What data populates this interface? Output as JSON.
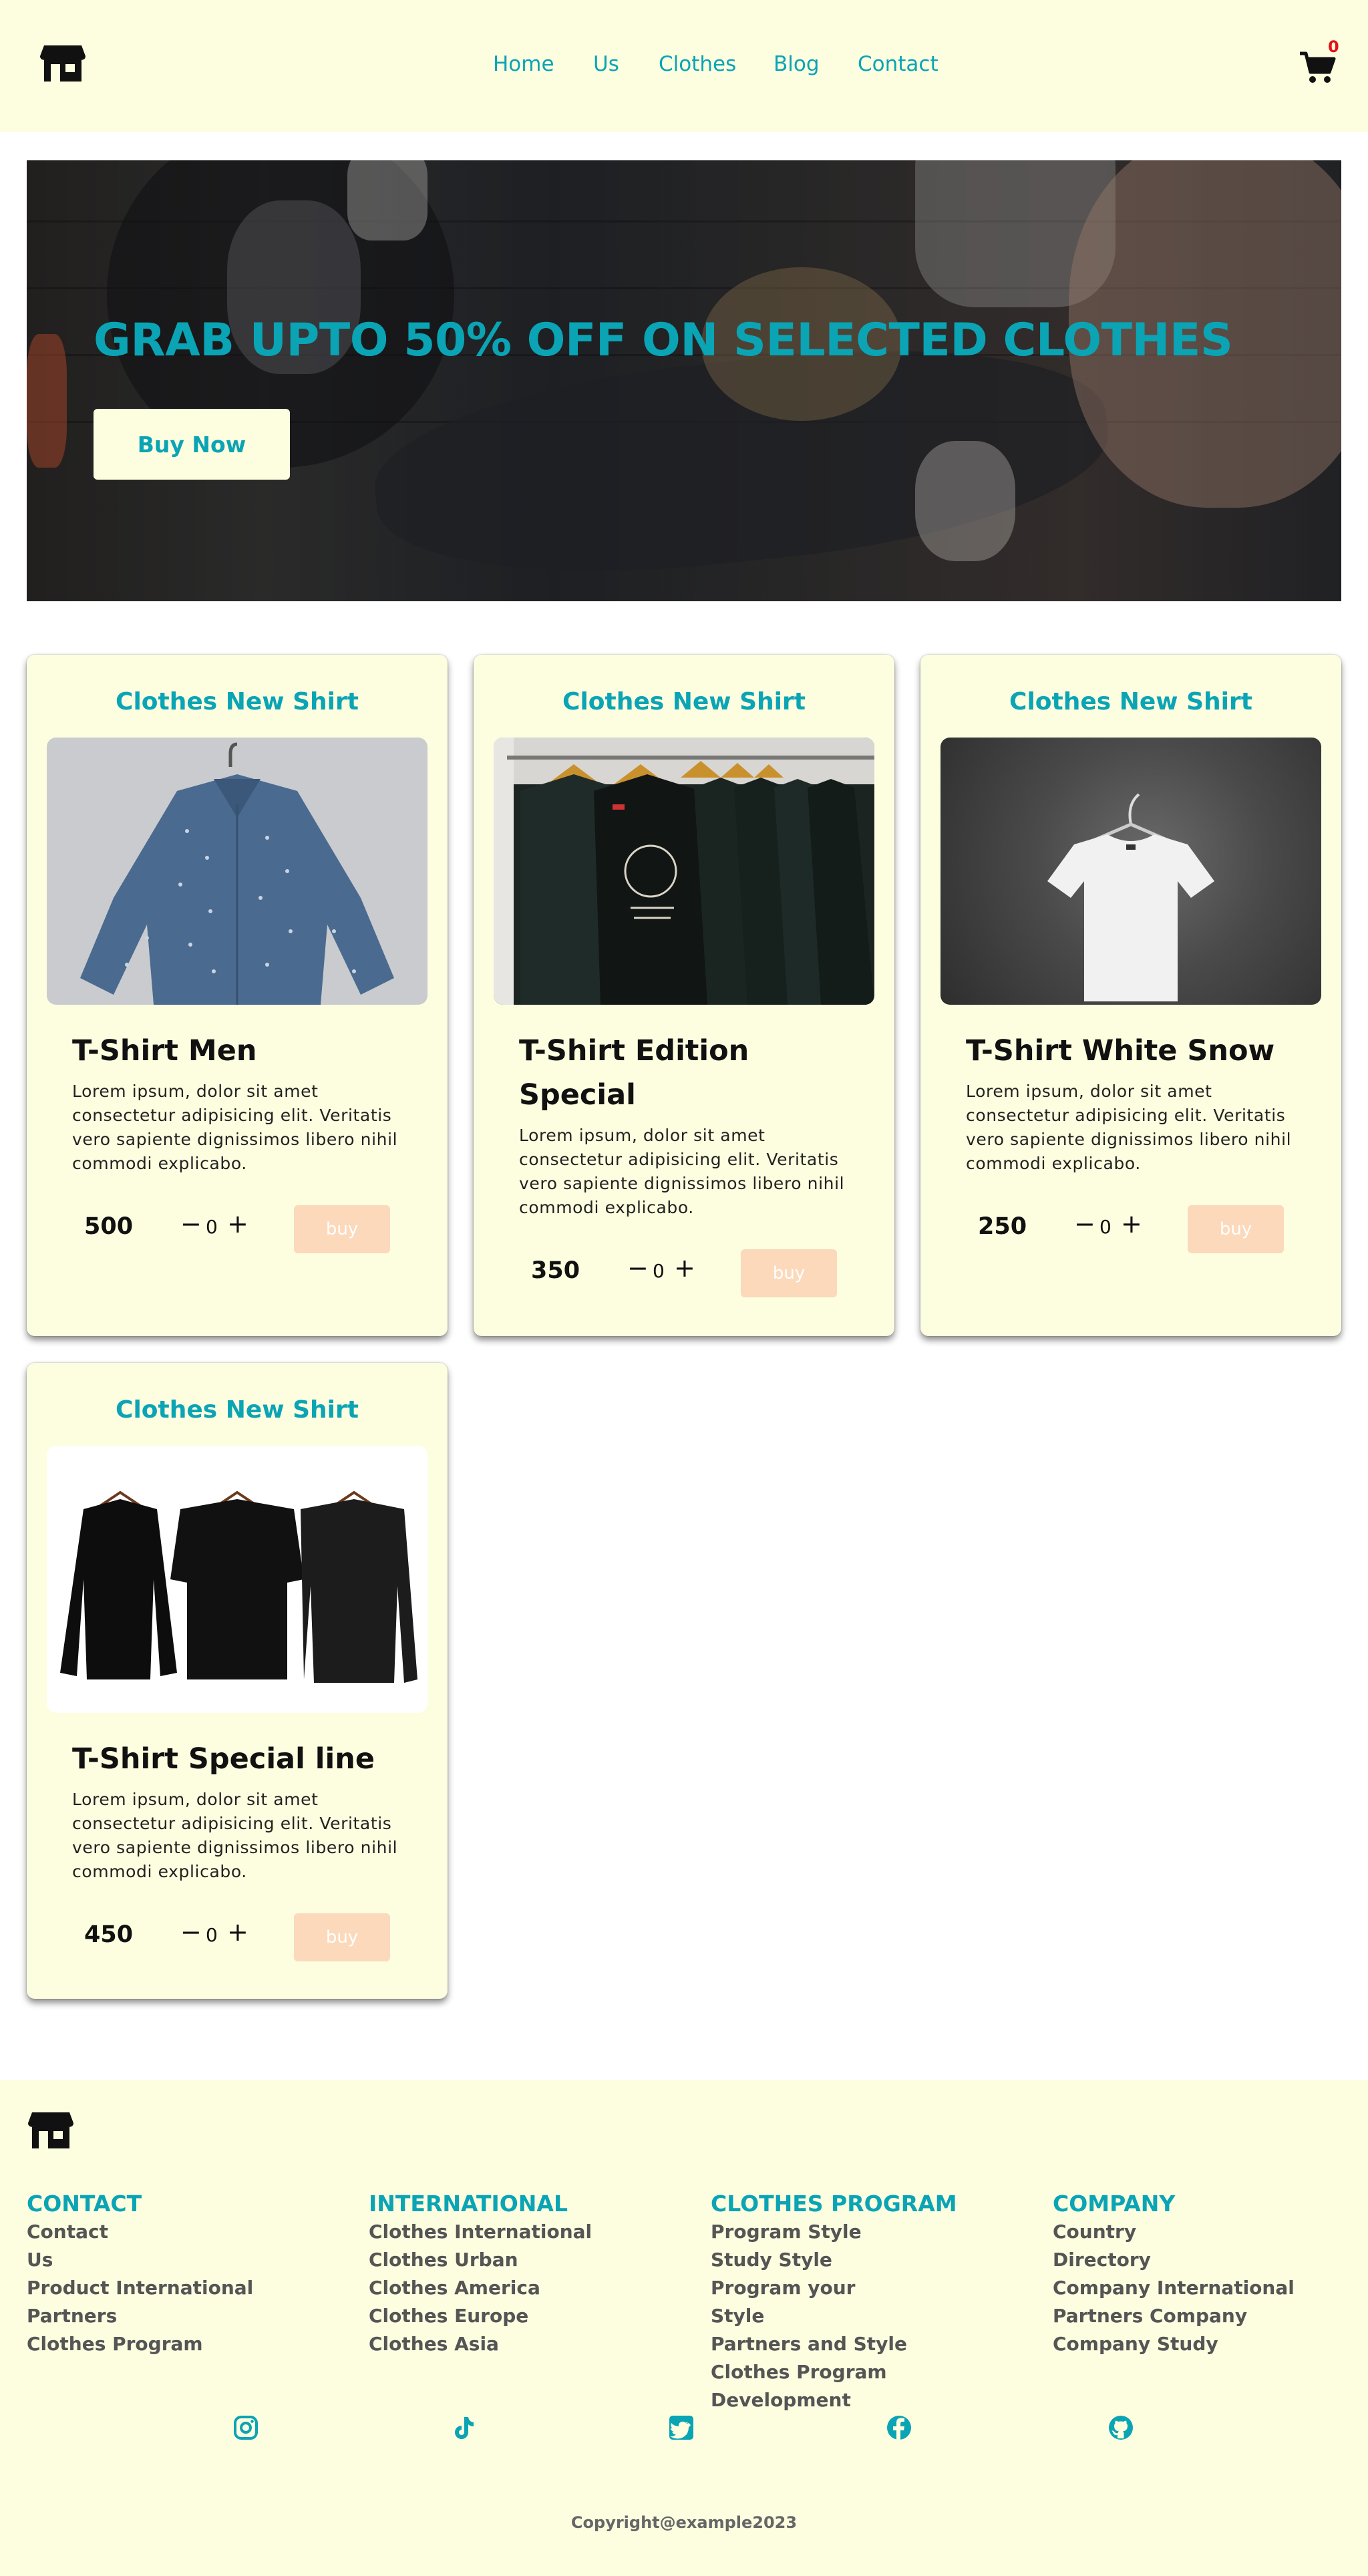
{
  "header": {
    "nav": [
      "Home",
      "Us",
      "Clothes",
      "Blog",
      "Contact"
    ],
    "cart_count": "0"
  },
  "hero": {
    "title": "GRAB UPTO 50% OFF ON SELECTED CLOTHES",
    "button_label": "Buy Now"
  },
  "products": [
    {
      "heading": "Clothes New Shirt",
      "title": "T-Shirt Men",
      "description": "Lorem ipsum, dolor sit amet consectetur adipisicing elit. Veritatis vero sapiente dignissimos libero nihil commodi explicabo.",
      "price": "500",
      "quantity": "0",
      "buy_label": "buy",
      "image_icon": "blue-dotted-shirt-icon"
    },
    {
      "heading": "Clothes New Shirt",
      "title": "T-Shirt Edition Special",
      "description": "Lorem ipsum, dolor sit amet consectetur adipisicing elit. Veritatis vero sapiente dignissimos libero nihil commodi explicabo.",
      "price": "350",
      "quantity": "0",
      "buy_label": "buy",
      "image_icon": "black-shirts-rack-icon"
    },
    {
      "heading": "Clothes New Shirt",
      "title": "T-Shirt White Snow",
      "description": "Lorem ipsum, dolor sit amet consectetur adipisicing elit. Veritatis vero sapiente dignissimos libero nihil commodi explicabo.",
      "price": "250",
      "quantity": "0",
      "buy_label": "buy",
      "image_icon": "white-tshirt-icon"
    },
    {
      "heading": "Clothes New Shirt",
      "title": "T-Shirt Special line",
      "description": "Lorem ipsum, dolor sit amet consectetur adipisicing elit. Veritatis vero sapiente dignissimos libero nihil commodi explicabo.",
      "price": "450",
      "quantity": "0",
      "buy_label": "buy",
      "image_icon": "three-black-shirts-icon"
    }
  ],
  "footer": {
    "columns": [
      {
        "heading": "CONTACT",
        "links": [
          "Contact",
          "Us",
          "Product International",
          "Partners",
          "Clothes Program"
        ]
      },
      {
        "heading": "INTERNATIONAL",
        "links": [
          "Clothes International",
          "Clothes Urban",
          "Clothes America",
          "Clothes Europe",
          "Clothes Asia"
        ]
      },
      {
        "heading": "CLOTHES PROGRAM",
        "links": [
          "Program Style",
          "Study Style",
          "Program your Style",
          "Partners and Style",
          "Clothes Program Development"
        ]
      },
      {
        "heading": "COMPANY",
        "links": [
          "Country",
          "Directory",
          "Company International",
          "Partners Company",
          "Company Study"
        ]
      }
    ],
    "social_icons": [
      "instagram-icon",
      "tiktok-icon",
      "twitter-icon",
      "facebook-icon",
      "github-icon"
    ],
    "copyright": "Copyright@example2023"
  },
  "colors": {
    "accent": "#0aa4b5",
    "background": "#fdfde0",
    "buy_button": "#fcd9bb",
    "cart_badge": "#e11414"
  }
}
